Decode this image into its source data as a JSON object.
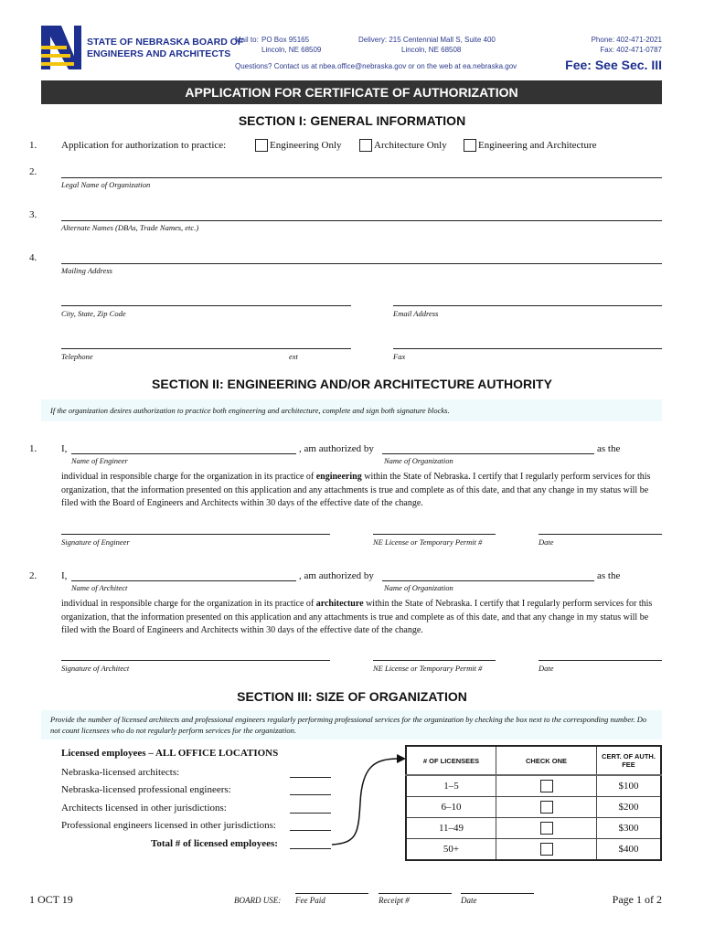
{
  "header": {
    "org_line1": "STATE OF NEBRASKA BOARD OF",
    "org_line2": "ENGINEERS AND ARCHITECTS",
    "mail_label": "Mail to:",
    "mail_line1": "PO Box 95165",
    "mail_line2": "Lincoln, NE 68509",
    "delivery_line1": "Delivery: 215 Centennial Mall S, Suite 400",
    "delivery_line2": "Lincoln, NE 68508",
    "phone": "Phone: 402-471-2021",
    "fax": "Fax: 402-471-0787",
    "questions": "Questions? Contact us at nbea.office@nebraska.gov or on the web at ea.nebraska.gov",
    "fee": "Fee: See Sec. III",
    "brand_color": "#1d2f8f",
    "accent_color": "#f2c511"
  },
  "title": "APPLICATION FOR CERTIFICATE OF AUTHORIZATION",
  "section1": {
    "title": "SECTION I:  GENERAL INFORMATION",
    "q1_num": "1.",
    "q1_text": "Application for authorization to practice:",
    "options": [
      "Engineering Only",
      "Architecture Only",
      "Engineering and Architecture"
    ],
    "q2_num": "2.",
    "q2_label": "Legal Name of Organization",
    "q3_num": "3.",
    "q3_label": "Alternate Names (DBAs, Trade Names, etc.)",
    "q4_num": "4.",
    "q4_label": "Mailing Address",
    "city_label": "City, State, Zip Code",
    "email_label": "Email Address",
    "telephone_label": "Telephone",
    "ext_label": "ext",
    "fax_label": "Fax"
  },
  "section2": {
    "title": "SECTION II: ENGINEERING AND/OR ARCHITECTURE AUTHORITY",
    "note": "If the organization desires authorization to practice both engineering and architecture, complete and sign both signature blocks.",
    "blocks": [
      {
        "num": "1.",
        "i": "I,",
        "authorized": ", am authorized by",
        "as_the": "as the",
        "name_label": "Name of Engineer",
        "org_label": "Name of Organization",
        "para_pre": "individual in responsible charge for the organization in its practice of ",
        "para_bold": "engineering",
        "para_post": " within the State of Nebraska. I certify that I regularly perform services for this organization, that the information presented on this application and any attachments is true and complete as of this date, and that any change in my status will be filed with the Board of Engineers and Architects within 30 days of the effective date of the change.",
        "sig_label": "Signature of Engineer",
        "license_label": "NE License or Temporary Permit #",
        "date_label": "Date"
      },
      {
        "num": "2.",
        "i": "I,",
        "authorized": ", am authorized by",
        "as_the": "as the",
        "name_label": "Name of Architect",
        "org_label": "Name of Organization",
        "para_pre": "individual in responsible charge for the organization in its practice of ",
        "para_bold": "architecture",
        "para_post": " within the State of Nebraska. I certify that I regularly perform services for this organization, that the information presented on this application and any attachments is true and complete as of this date, and that any change in my status will be filed with the Board of Engineers and Architects within 30 days of the effective date of the change.",
        "sig_label": "Signature of Architect",
        "license_label": "NE License or Temporary Permit #",
        "date_label": "Date"
      }
    ]
  },
  "section3": {
    "title": "SECTION III: SIZE OF ORGANIZATION",
    "note": "Provide the number of licensed architects and professional engineers regularly performing professional services for the organization by checking the box next to the corresponding number. Do not count licensees who do not regularly perform services for the organization.",
    "list_heading": "Licensed employees – ALL OFFICE LOCATIONS",
    "items": [
      "Nebraska-licensed architects:",
      "Nebraska-licensed professional engineers:",
      "Architects licensed in other jurisdictions:",
      "Professional engineers licensed in other jurisdictions:"
    ],
    "total": "Total # of licensed employees:",
    "table": {
      "headers": [
        "# OF LICENSEES",
        "CHECK ONE",
        "CERT. OF AUTH. FEE"
      ],
      "rows": [
        {
          "range": "1–5",
          "fee": "$100"
        },
        {
          "range": "6–10",
          "fee": "$200"
        },
        {
          "range": "11–49",
          "fee": "$300"
        },
        {
          "range": "50+",
          "fee": "$400"
        }
      ]
    }
  },
  "footer": {
    "version": "1 OCT 19",
    "board_use": "BOARD USE:",
    "fee_paid": "Fee Paid",
    "receipt": "Receipt #",
    "date": "Date",
    "page": "Page 1 of 2"
  }
}
